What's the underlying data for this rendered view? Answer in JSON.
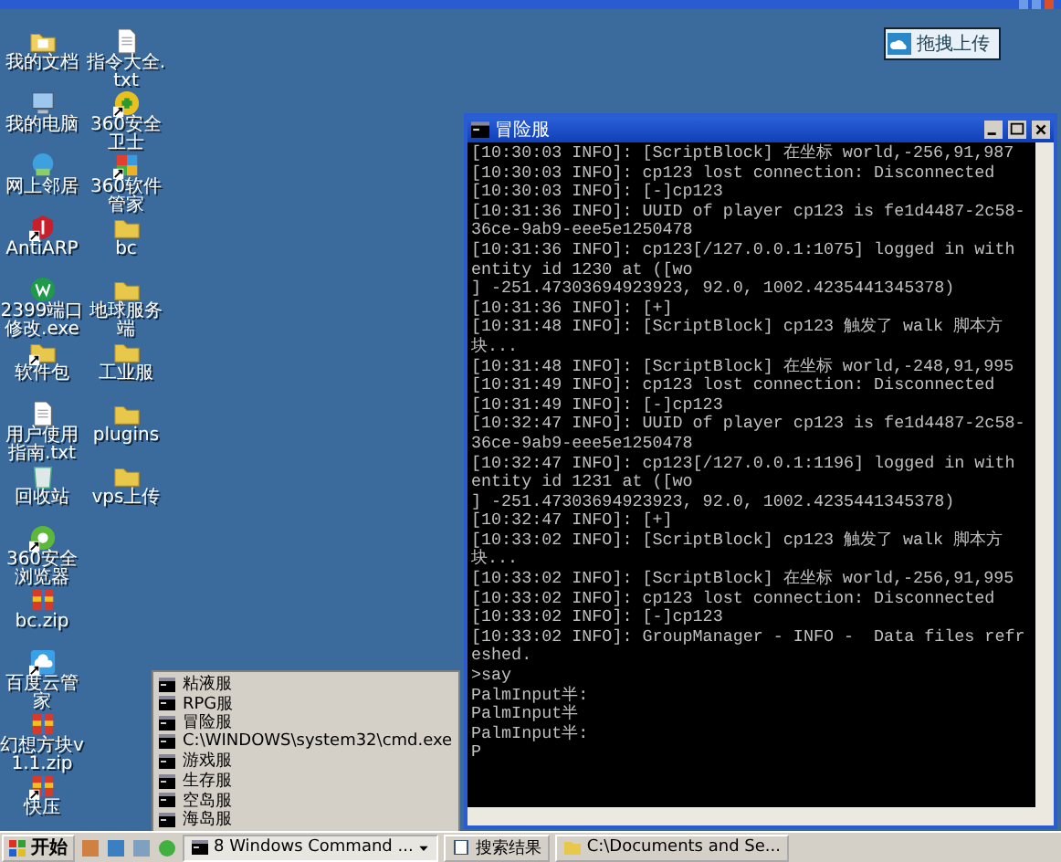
{
  "upload_widget": {
    "label": "拖拽上传"
  },
  "desktop": {
    "columns": [
      [
        {
          "label": "我的文档",
          "kind": "documents",
          "shortcut": false
        },
        {
          "label": "我的电脑",
          "kind": "computer",
          "shortcut": false
        },
        {
          "label": "网上邻居",
          "kind": "network",
          "shortcut": false
        },
        {
          "label": "AntiARP",
          "kind": "shield",
          "shortcut": true
        },
        {
          "label": "2399端口修改.exe",
          "kind": "app",
          "shortcut": false
        },
        {
          "label": "软件包",
          "kind": "folder",
          "shortcut": true
        },
        {
          "label": "用户使用指南.txt",
          "kind": "textfile",
          "shortcut": false
        },
        {
          "label": "回收站",
          "kind": "recycle",
          "shortcut": false
        },
        {
          "label": "360安全浏览器",
          "kind": "browser",
          "shortcut": true
        },
        {
          "label": "bc.zip",
          "kind": "archive",
          "shortcut": false
        },
        {
          "label": "百度云管家",
          "kind": "cloud",
          "shortcut": true
        },
        {
          "label": "幻想方块v1.1.zip",
          "kind": "archive",
          "shortcut": false
        },
        {
          "label": "快压",
          "kind": "archive",
          "shortcut": true
        }
      ],
      [
        {
          "label": "指令大全.txt",
          "kind": "textfile",
          "shortcut": false
        },
        {
          "label": "360安全卫士",
          "kind": "guard",
          "shortcut": true
        },
        {
          "label": "360软件管家",
          "kind": "apps",
          "shortcut": true
        },
        {
          "label": "bc",
          "kind": "folder",
          "shortcut": false
        },
        {
          "label": "地球服务端",
          "kind": "folder",
          "shortcut": false
        },
        {
          "label": "工业服",
          "kind": "folder",
          "shortcut": false
        },
        {
          "label": "plugins",
          "kind": "folder",
          "shortcut": false
        },
        {
          "label": "vps上传",
          "kind": "folder",
          "shortcut": false
        }
      ]
    ]
  },
  "console": {
    "title": "冒险服",
    "lines": [
      "[10:30:03 INFO]: [ScriptBlock] 在坐标 world,-256,91,987",
      "[10:30:03 INFO]: cp123 lost connection: Disconnected",
      "[10:30:03 INFO]: [-]cp123",
      "[10:31:36 INFO]: UUID of player cp123 is fe1d4487-2c58-36ce-9ab9-eee5e1250478",
      "[10:31:36 INFO]: cp123[/127.0.0.1:1075] logged in with entity id 1230 at ([wo",
      "] -251.47303694923923, 92.0, 1002.4235441345378)",
      "[10:31:36 INFO]: [+]",
      "[10:31:48 INFO]: [ScriptBlock] cp123 触发了 walk 脚本方块...",
      "[10:31:48 INFO]: [ScriptBlock] 在坐标 world,-248,91,995",
      "[10:31:49 INFO]: cp123 lost connection: Disconnected",
      "[10:31:49 INFO]: [-]cp123",
      "[10:32:47 INFO]: UUID of player cp123 is fe1d4487-2c58-36ce-9ab9-eee5e1250478",
      "[10:32:47 INFO]: cp123[/127.0.0.1:1196] logged in with entity id 1231 at ([wo",
      "] -251.47303694923923, 92.0, 1002.4235441345378)",
      "[10:32:47 INFO]: [+]",
      "[10:33:02 INFO]: [ScriptBlock] cp123 触发了 walk 脚本方块...",
      "[10:33:02 INFO]: [ScriptBlock] 在坐标 world,-256,91,995",
      "[10:33:02 INFO]: cp123 lost connection: Disconnected",
      "[10:33:02 INFO]: [-]cp123",
      "[10:33:02 INFO]: GroupManager - INFO -  Data files refreshed.",
      ">say",
      "PalmInput半:",
      "PalmInput半",
      "PalmInput半:",
      "P"
    ]
  },
  "task_menu": {
    "items": [
      "粘液服",
      "RPG服",
      "冒险服",
      "C:\\WINDOWS\\system32\\cmd.exe",
      "游戏服",
      "生存服",
      "空岛服",
      "海岛服"
    ]
  },
  "taskbar": {
    "start": "开始",
    "tasks": [
      {
        "label": "8 Windows Command ...",
        "kind": "group",
        "selected": true
      },
      {
        "label": "搜索结果",
        "kind": "search",
        "selected": false
      },
      {
        "label": "C:\\Documents and Se...",
        "kind": "folder",
        "selected": false
      }
    ]
  }
}
